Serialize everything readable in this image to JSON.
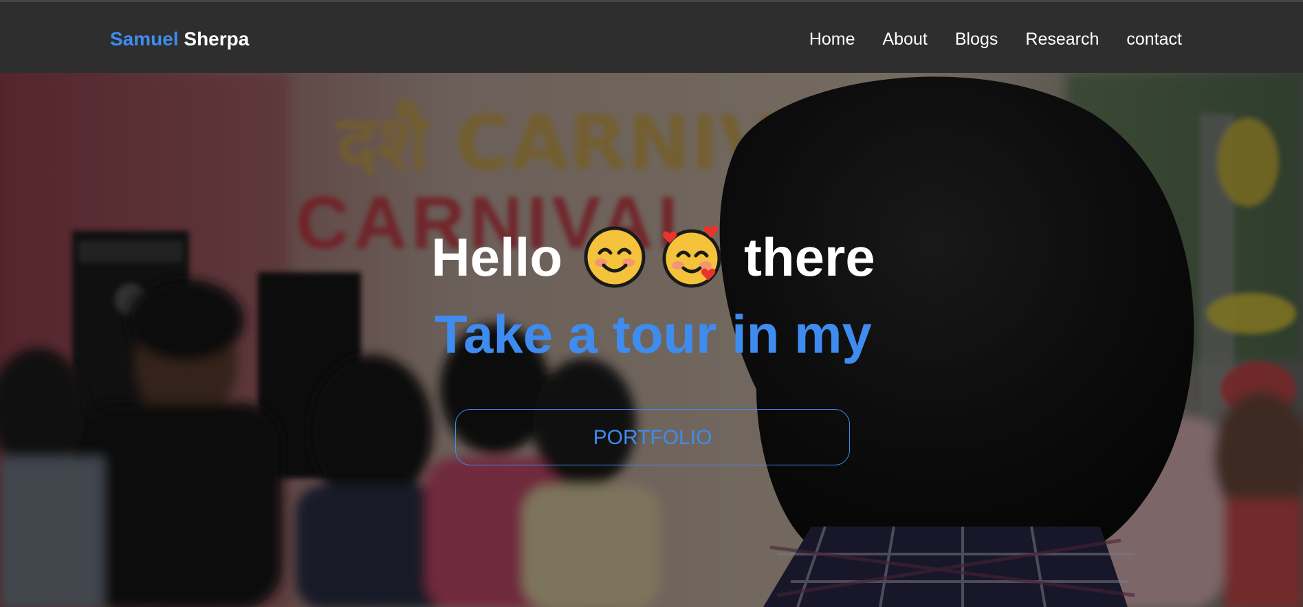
{
  "navbar": {
    "brand_first": "Samuel",
    "brand_last": "Sherpa",
    "links": [
      {
        "label": "Home"
      },
      {
        "label": "About"
      },
      {
        "label": "Blogs"
      },
      {
        "label": "Research"
      },
      {
        "label": "contact"
      }
    ]
  },
  "hero": {
    "greeting_before": "Hello",
    "greeting_after": "there",
    "emojis": [
      "smiling-face-icon",
      "smiling-face-with-hearts-icon"
    ],
    "tagline": "Take a tour in my",
    "button_label": "PORTFOLIO",
    "background_text": "दशै CARNIVAL"
  },
  "colors": {
    "accent": "#3f8cf0",
    "navbar_bg": "#2e2e2e",
    "text_light": "#ffffff"
  }
}
